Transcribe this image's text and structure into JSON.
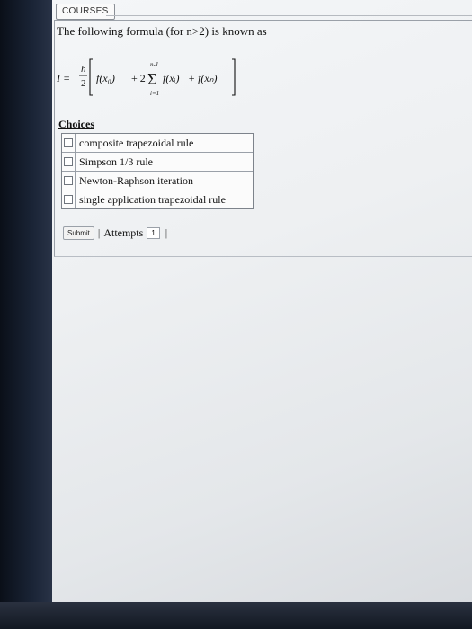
{
  "nav": {
    "courses_label": "COURSES"
  },
  "question": {
    "text": "The following formula (for n>2) is known as"
  },
  "formula": {
    "lhs": "I =",
    "numerator": "h",
    "denominator": "2",
    "upper_limit": "n-1",
    "lower_limit": "i=1",
    "term_first": "f(x₀)",
    "coefficient": "+ 2",
    "term_sum": "f(xᵢ)",
    "term_last": "+ f(xₙ)"
  },
  "choices": {
    "title": "Choices",
    "options": [
      "composite trapezoidal rule",
      "Simpson 1/3 rule",
      "Newton-Raphson iteration",
      "single application trapezoidal rule"
    ]
  },
  "footer": {
    "submit_label": "Submit",
    "attempts_label": "Attempts",
    "attempts_value": "1"
  }
}
